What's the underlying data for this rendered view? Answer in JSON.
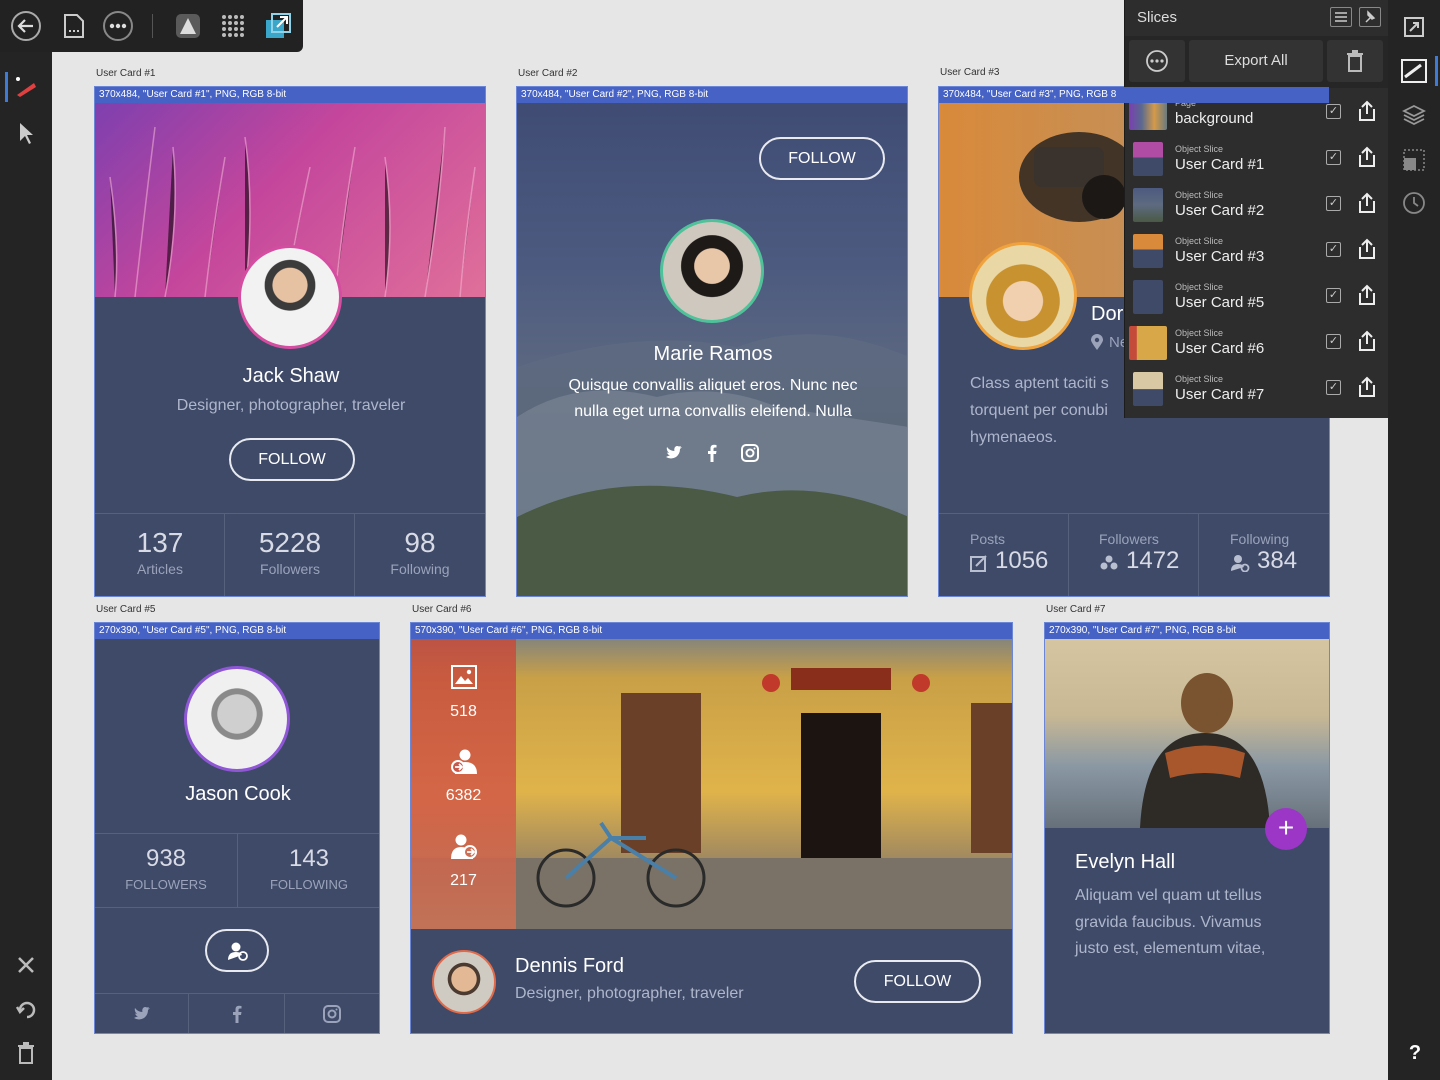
{
  "slices_panel": {
    "title": "Slices",
    "export_all": "Export All",
    "items": [
      {
        "kind": "Page",
        "name": "background"
      },
      {
        "kind": "Object Slice",
        "name": "User Card #1"
      },
      {
        "kind": "Object Slice",
        "name": "User Card #2"
      },
      {
        "kind": "Object Slice",
        "name": "User Card #3"
      },
      {
        "kind": "Object Slice",
        "name": "User Card #5"
      },
      {
        "kind": "Object Slice",
        "name": "User Card #6"
      },
      {
        "kind": "Object Slice",
        "name": "User Card #7"
      }
    ],
    "check": "✓"
  },
  "cards": {
    "c1": {
      "label": "User Card #1",
      "info": "370x484, \"User Card #1\", PNG, RGB 8-bit",
      "name": "Jack Shaw",
      "subtitle": "Designer, photographer, traveler",
      "follow": "FOLLOW",
      "stats": [
        {
          "num": "137",
          "lbl": "Articles"
        },
        {
          "num": "5228",
          "lbl": "Followers"
        },
        {
          "num": "98",
          "lbl": "Following"
        }
      ]
    },
    "c2": {
      "label": "User Card #2",
      "info": "370x484, \"User Card #2\", PNG, RGB 8-bit",
      "name": "Marie Ramos",
      "follow": "FOLLOW",
      "text_line1": "Quisque convallis aliquet eros. Nunc nec",
      "text_line2": "nulla eget urna convallis eleifend. Nulla"
    },
    "c3": {
      "label": "User Card #3",
      "info": "370x484, \"User Card #3\", PNG, RGB 8",
      "name": "Dor",
      "location": "Ne",
      "text_line1": "Class aptent taciti s",
      "text_line2": "torquent per conubi",
      "text_line3": "hymenaeos.",
      "stats": [
        {
          "lbl": "Posts",
          "num": "1056"
        },
        {
          "lbl": "Followers",
          "num": "1472"
        },
        {
          "lbl": "Following",
          "num": "384"
        }
      ]
    },
    "c5": {
      "label": "User Card #5",
      "info": "270x390, \"User Card #5\", PNG, RGB 8-bit",
      "name": "Jason Cook",
      "stats": [
        {
          "num": "938",
          "lbl": "FOLLOWERS"
        },
        {
          "num": "143",
          "lbl": "FOLLOWING"
        }
      ]
    },
    "c6": {
      "label": "User Card #6",
      "info": "570x390, \"User Card #6\", PNG, RGB 8-bit",
      "name": "Dennis Ford",
      "subtitle": "Designer, photographer, traveler",
      "follow": "FOLLOW",
      "stats": [
        "518",
        "6382",
        "217"
      ]
    },
    "c7": {
      "label": "User Card #7",
      "info": "270x390, \"User Card #7\", PNG, RGB 8-bit",
      "name": "Evelyn Hall",
      "text_line1": "Aliquam vel quam ut tellus",
      "text_line2": "gravida faucibus. Vivamus",
      "text_line3": "justo est, elementum vitae,"
    }
  },
  "help": "?"
}
